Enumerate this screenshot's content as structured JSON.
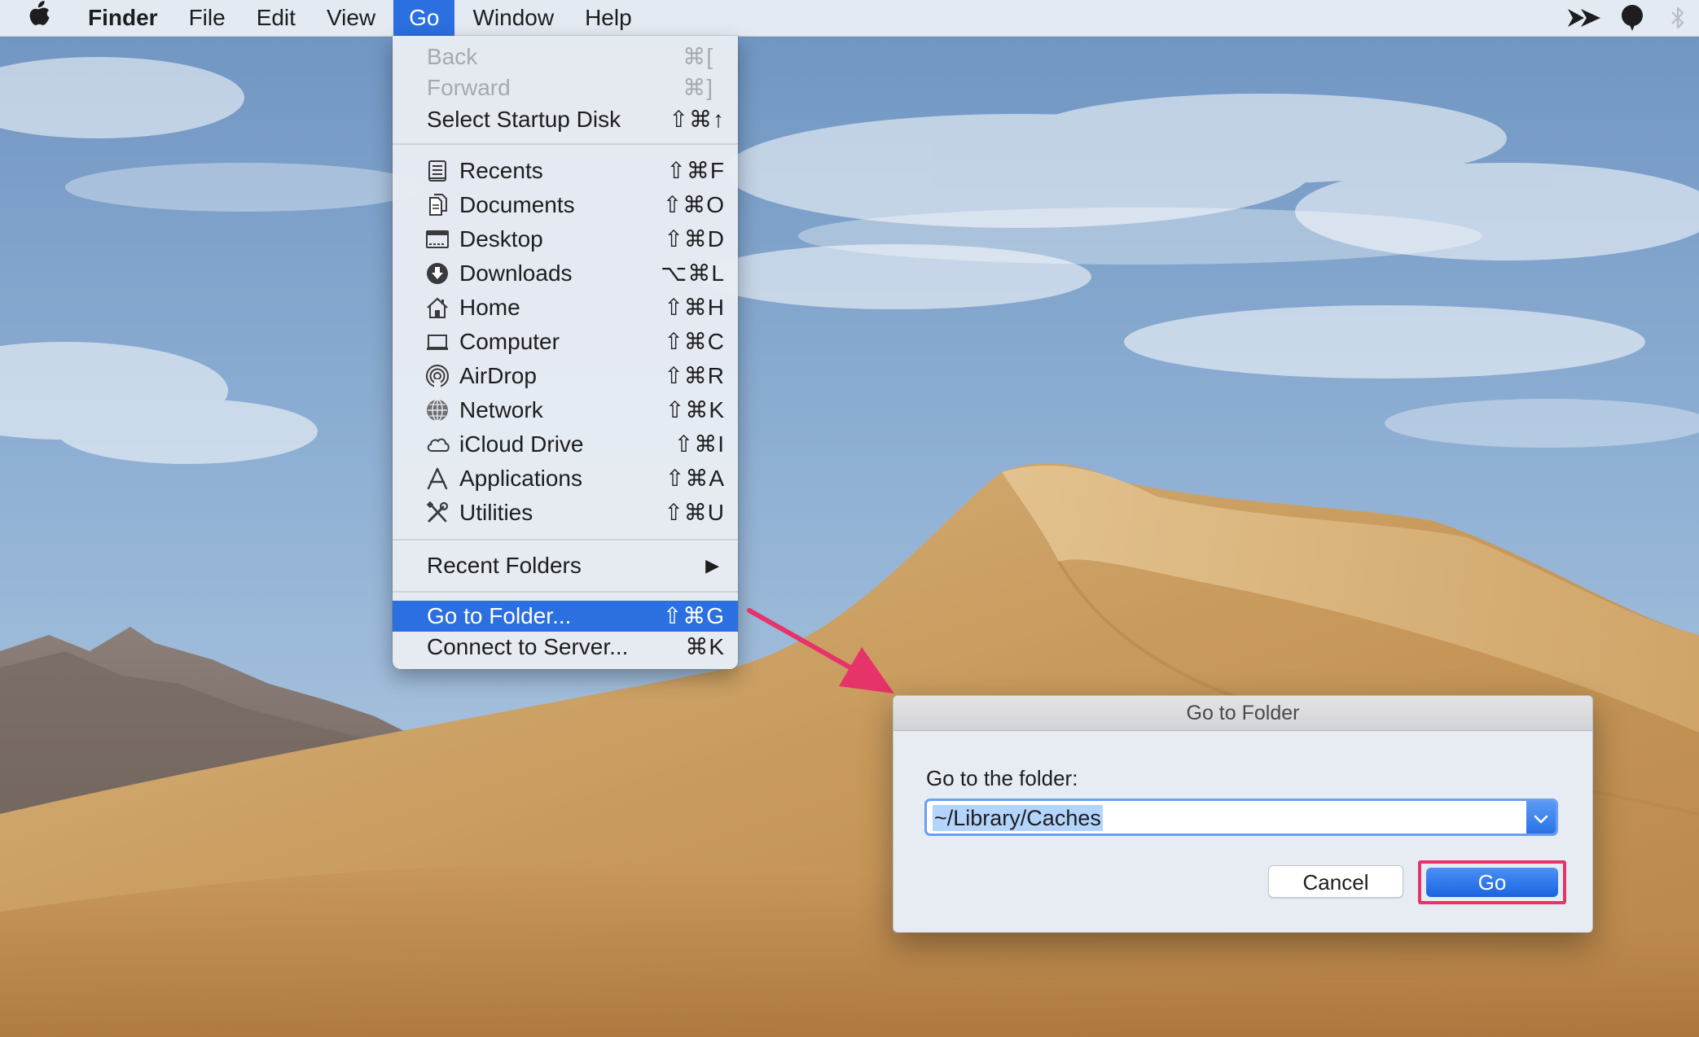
{
  "menubar": {
    "app_name": "Finder",
    "menus": [
      "File",
      "Edit",
      "View",
      "Go",
      "Window",
      "Help"
    ],
    "status_icons": [
      "double-chevron-icon",
      "balloon-icon",
      "bluetooth-icon"
    ]
  },
  "go_menu": {
    "items": [
      {
        "label": "Back",
        "shortcut": "⌘[",
        "enabled": false
      },
      {
        "label": "Forward",
        "shortcut": "⌘]",
        "enabled": false
      },
      {
        "label": "Select Startup Disk",
        "shortcut": "⇧⌘↑",
        "enabled": true
      },
      {
        "label": "Recents",
        "shortcut": "⇧⌘F",
        "icon": "recents-icon"
      },
      {
        "label": "Documents",
        "shortcut": "⇧⌘O",
        "icon": "documents-icon"
      },
      {
        "label": "Desktop",
        "shortcut": "⇧⌘D",
        "icon": "desktop-icon"
      },
      {
        "label": "Downloads",
        "shortcut": "⌥⌘L",
        "icon": "downloads-icon"
      },
      {
        "label": "Home",
        "shortcut": "⇧⌘H",
        "icon": "home-icon"
      },
      {
        "label": "Computer",
        "shortcut": "⇧⌘C",
        "icon": "computer-icon"
      },
      {
        "label": "AirDrop",
        "shortcut": "⇧⌘R",
        "icon": "airdrop-icon"
      },
      {
        "label": "Network",
        "shortcut": "⇧⌘K",
        "icon": "network-icon"
      },
      {
        "label": "iCloud Drive",
        "shortcut": "⇧⌘I",
        "icon": "icloud-icon"
      },
      {
        "label": "Applications",
        "shortcut": "⇧⌘A",
        "icon": "applications-icon"
      },
      {
        "label": "Utilities",
        "shortcut": "⇧⌘U",
        "icon": "utilities-icon"
      },
      {
        "label": "Recent Folders",
        "shortcut": "▶"
      },
      {
        "label": "Go to Folder...",
        "shortcut": "⇧⌘G",
        "highlighted": true
      },
      {
        "label": "Connect to Server...",
        "shortcut": "⌘K"
      }
    ]
  },
  "dialog": {
    "title": "Go to Folder",
    "prompt": "Go to the folder:",
    "folder_value": "~/Library/Caches",
    "cancel_label": "Cancel",
    "go_label": "Go"
  },
  "colors": {
    "menu_highlight": "#2b6fe0",
    "annotation_pink": "#e6336a",
    "button_blue": "#1a64e0"
  }
}
